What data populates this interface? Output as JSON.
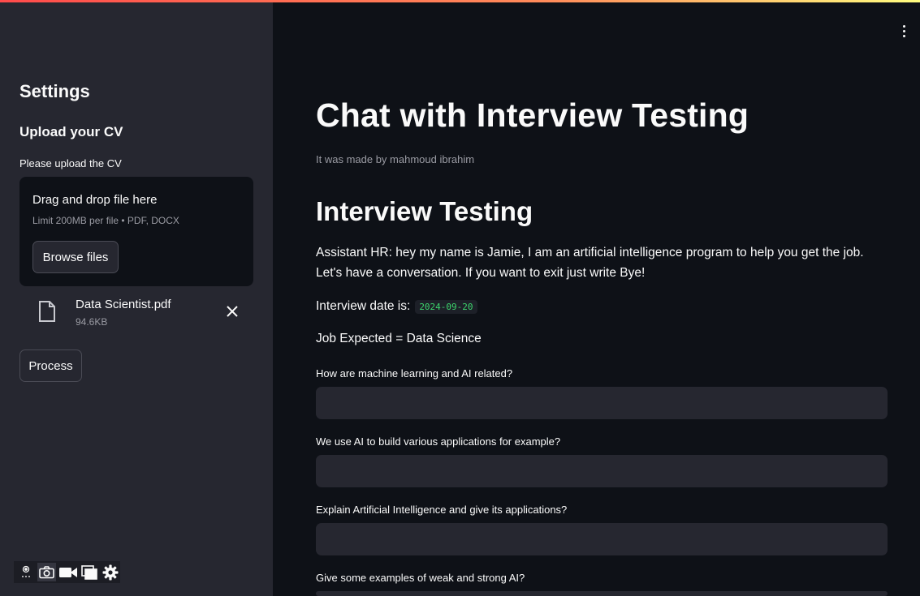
{
  "sidebar": {
    "title": "Settings",
    "upload_header": "Upload your CV",
    "upload_label": "Please upload the CV",
    "dropzone": {
      "title": "Drag and drop file here",
      "limit": "Limit 200MB per file • PDF, DOCX",
      "browse_label": "Browse files"
    },
    "file": {
      "name": "Data Scientist.pdf",
      "size": "94.6KB"
    },
    "process_label": "Process"
  },
  "toolbar_icons": [
    "record-icon",
    "camera-icon",
    "video-icon",
    "window-icon",
    "gear-icon"
  ],
  "main": {
    "title": "Chat with Interview Testing",
    "caption": "It was made by mahmoud ibrahim",
    "section_title": "Interview Testing",
    "assistant_message": "Assistant HR: hey my name is Jamie, I am an artificial intelligence program to help you get the job. Let's have a conversation. If you want to exit just write Bye!",
    "date_prefix": "Interview date is:",
    "date_value": "2024-09-20",
    "job_expected": "Job Expected = Data Science",
    "questions": [
      {
        "label": "How are machine learning and AI related?",
        "value": ""
      },
      {
        "label": "We use AI to build various applications for example?",
        "value": ""
      },
      {
        "label": "Explain Artificial Intelligence and give its applications?",
        "value": ""
      },
      {
        "label": "Give some examples of weak and strong AI?",
        "value": ""
      }
    ]
  },
  "colors": {
    "sidebar_bg": "#262730",
    "main_bg": "#0e1117",
    "accent": "#ff4b4b",
    "code_green": "#3dd56d"
  }
}
